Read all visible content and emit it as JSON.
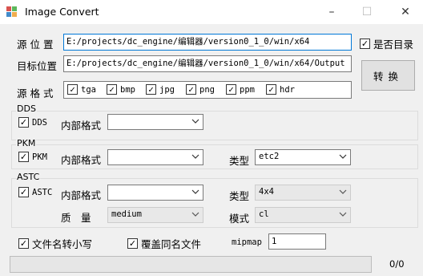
{
  "window": {
    "title": "Image Convert"
  },
  "source_dir": {
    "label": "源 位 置",
    "value": "E:/projects/dc_engine/编辑器/version0_1_0/win/x64"
  },
  "target_dir": {
    "label": "目标位置",
    "value": "E:/projects/dc_engine/编辑器/version0_1_0/win/x64/Output"
  },
  "is_dir": {
    "label": "是否目录",
    "checked": true
  },
  "source_format": {
    "label": "源 格 式",
    "items": [
      {
        "label": "tga",
        "checked": true
      },
      {
        "label": "bmp",
        "checked": true
      },
      {
        "label": "jpg",
        "checked": true
      },
      {
        "label": "png",
        "checked": true
      },
      {
        "label": "ppm",
        "checked": true
      },
      {
        "label": "hdr",
        "checked": true
      }
    ]
  },
  "convert_button": {
    "label": "转换"
  },
  "dds": {
    "group": "DDS",
    "checkbox": "DDS",
    "checked": true,
    "internal_label": "内部格式",
    "internal_value": ""
  },
  "pkm": {
    "group": "PKM",
    "checkbox": "PKM",
    "checked": true,
    "internal_label": "内部格式",
    "internal_value": "",
    "type_label": "类型",
    "type_value": "etc2"
  },
  "astc": {
    "group": "ASTC",
    "checkbox": "ASTC",
    "checked": true,
    "internal_label": "内部格式",
    "internal_value": "",
    "type_label": "类型",
    "type_value": "4x4",
    "quality_label": "质　量",
    "quality_value": "medium",
    "mode_label": "模式",
    "mode_value": "cl"
  },
  "options": {
    "lowercase": {
      "label": "文件名转小写",
      "checked": true
    },
    "overwrite": {
      "label": "覆盖同名文件",
      "checked": true
    },
    "mipmap_label": "mipmap",
    "mipmap_value": "1"
  },
  "progress": {
    "fraction": 0,
    "text": "0/0"
  },
  "icons": {
    "check": "✓",
    "minimize": "–",
    "maximize": "☐",
    "close": "✕"
  }
}
